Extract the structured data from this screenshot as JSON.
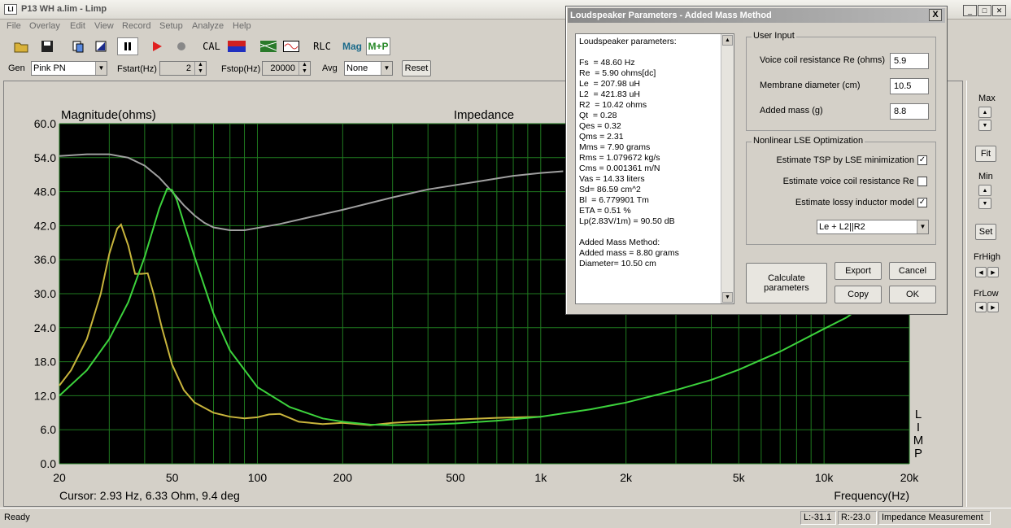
{
  "window": {
    "title": "P13 WH a.lim - Limp",
    "icon_text": "LI"
  },
  "menu": [
    "File",
    "Overlay",
    "Edit",
    "View",
    "Record",
    "Setup",
    "Analyze",
    "Help"
  ],
  "toolbar": {
    "cal_label": "CAL",
    "rlc_label": "RLC",
    "mag_label": "Mag",
    "mp_label": "M+P"
  },
  "genbar": {
    "gen_label": "Gen",
    "gen_value": "Pink PN",
    "fstart_label": "Fstart(Hz)",
    "fstart_value": "2",
    "fstop_label": "Fstop(Hz)",
    "fstop_value": "20000",
    "avg_label": "Avg",
    "avg_value": "None",
    "reset_label": "Reset"
  },
  "chart_data": {
    "type": "line",
    "title": "Impedance",
    "ylabel": "Magnitude(ohms)",
    "xlabel": "Frequency(Hz)",
    "x_scale": "log",
    "xlim": [
      20,
      20000
    ],
    "ylim": [
      0,
      60
    ],
    "yticks": [
      "60.0",
      "54.0",
      "48.0",
      "42.0",
      "36.0",
      "30.0",
      "24.0",
      "18.0",
      "12.0",
      "6.0",
      "0.0"
    ],
    "xticks": [
      "20",
      "50",
      "100",
      "200",
      "500",
      "1k",
      "2k",
      "5k",
      "10k",
      "20k"
    ],
    "side_label": "LIMP",
    "grid": true,
    "background": "#000000",
    "series": [
      {
        "color": "#a0a0a0",
        "x": [
          20,
          25,
          30,
          35,
          40,
          45,
          50,
          55,
          60,
          65,
          70,
          80,
          90,
          100,
          120,
          150,
          200,
          300,
          400,
          600,
          800,
          1000,
          1200
        ],
        "y": [
          54.3,
          54.6,
          54.6,
          54.0,
          52.6,
          50.5,
          48.0,
          45.6,
          43.8,
          42.5,
          41.7,
          41.2,
          41.2,
          41.6,
          42.3,
          43.4,
          44.8,
          47.0,
          48.4,
          49.8,
          50.8,
          51.3,
          51.6
        ]
      },
      {
        "color": "#c8b43c",
        "x": [
          20,
          22,
          25,
          28,
          30,
          32,
          33,
          35,
          37,
          39,
          41,
          43,
          46,
          50,
          55,
          60,
          70,
          80,
          90,
          100,
          110,
          120,
          140,
          170,
          200,
          250,
          300,
          400,
          500,
          700,
          1000
        ],
        "y": [
          13.8,
          16.5,
          22.0,
          30.0,
          37.0,
          41.5,
          42.2,
          38.5,
          33.5,
          33.5,
          33.6,
          30.0,
          24.0,
          17.5,
          13.0,
          10.8,
          9.0,
          8.3,
          8.0,
          8.2,
          8.7,
          8.8,
          7.4,
          7.0,
          7.2,
          6.8,
          7.2,
          7.6,
          7.8,
          8.1,
          8.3
        ]
      },
      {
        "color": "#3cd23c",
        "x": [
          20,
          25,
          30,
          35,
          40,
          45,
          48,
          50,
          52,
          55,
          60,
          70,
          80,
          100,
          130,
          170,
          200,
          250,
          300,
          400,
          500,
          700,
          1000,
          1500,
          2000,
          3000,
          4000,
          5000,
          7000,
          10000,
          12000,
          13000
        ],
        "y": [
          12.0,
          16.5,
          22.0,
          28.5,
          36.5,
          45.0,
          48.5,
          48.3,
          46.5,
          42.5,
          36.5,
          26.5,
          20.0,
          13.5,
          10.0,
          8.0,
          7.4,
          6.9,
          6.8,
          6.9,
          7.1,
          7.6,
          8.3,
          9.6,
          10.8,
          13.0,
          14.8,
          16.6,
          19.8,
          23.8,
          25.8,
          27.0
        ]
      }
    ]
  },
  "cursor_text": "Cursor: 2.93 Hz, 6.33 Ohm, 9.4 deg",
  "right_panel": {
    "max_label": "Max",
    "fit_label": "Fit",
    "min_label": "Min",
    "set_label": "Set",
    "frhigh_label": "FrHigh",
    "frlow_label": "FrLow"
  },
  "status": {
    "ready": "Ready",
    "l_value": "L:-31.1",
    "r_value": "R:-23.0",
    "mode": "Impedance Measurement"
  },
  "dialog": {
    "title": "Loudspeaker Parameters - Added Mass Method",
    "close": "X",
    "params_lines": [
      "Loudspeaker parameters:",
      "",
      "Fs  = 48.60 Hz",
      "Re  = 5.90 ohms[dc]",
      "Le  = 207.98 uH",
      "L2  = 421.83 uH",
      "R2  = 10.42 ohms",
      "Qt  = 0.28",
      "Qes = 0.32",
      "Qms = 2.31",
      "Mms = 7.90 grams",
      "Rms = 1.079672 kg/s",
      "Cms = 0.001361 m/N",
      "Vas = 14.33 liters",
      "Sd= 86.59 cm^2",
      "Bl  = 6.779901 Tm",
      "ETA = 0.51 %",
      "Lp(2.83V/1m) = 90.50 dB",
      "",
      "Added Mass Method:",
      "Added mass = 8.80 grams",
      "Diameter= 10.50 cm"
    ],
    "user_input": {
      "title": "User Input",
      "re_label": "Voice coil resistance Re (ohms)",
      "re_value": "5.9",
      "diam_label": "Membrane diameter (cm)",
      "diam_value": "10.5",
      "mass_label": "Added mass (g)",
      "mass_value": "8.8"
    },
    "nonlinear": {
      "title": "Nonlinear LSE Optimization",
      "opt1_label": "Estimate TSP by LSE minimization",
      "opt1_checked": true,
      "opt2_label": "Estimate voice coil resistance Re",
      "opt2_checked": false,
      "opt3_label": "Estimate lossy inductor model",
      "opt3_checked": true,
      "model_value": "Le + L2||R2"
    },
    "buttons": {
      "calculate": "Calculate parameters",
      "export": "Export",
      "cancel": "Cancel",
      "copy": "Copy",
      "ok": "OK"
    }
  }
}
